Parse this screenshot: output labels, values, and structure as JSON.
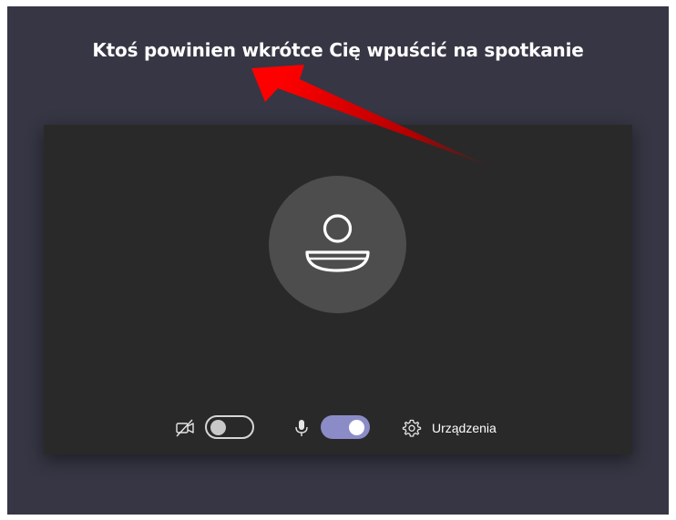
{
  "lobby": {
    "title": "Ktoś powinien wkrótce Cię wpuścić na spotkanie"
  },
  "controls": {
    "camera": {
      "icon": "camera-off-icon",
      "state": "off"
    },
    "microphone": {
      "icon": "microphone-icon",
      "state": "on"
    },
    "devices": {
      "icon": "gear-icon",
      "label": "Urządzenia"
    }
  },
  "colors": {
    "background": "#363644",
    "preview": "#292929",
    "avatar": "#4d4d4d",
    "toggle_on": "#8b8cc7",
    "annotation_arrow": "#e00000"
  }
}
